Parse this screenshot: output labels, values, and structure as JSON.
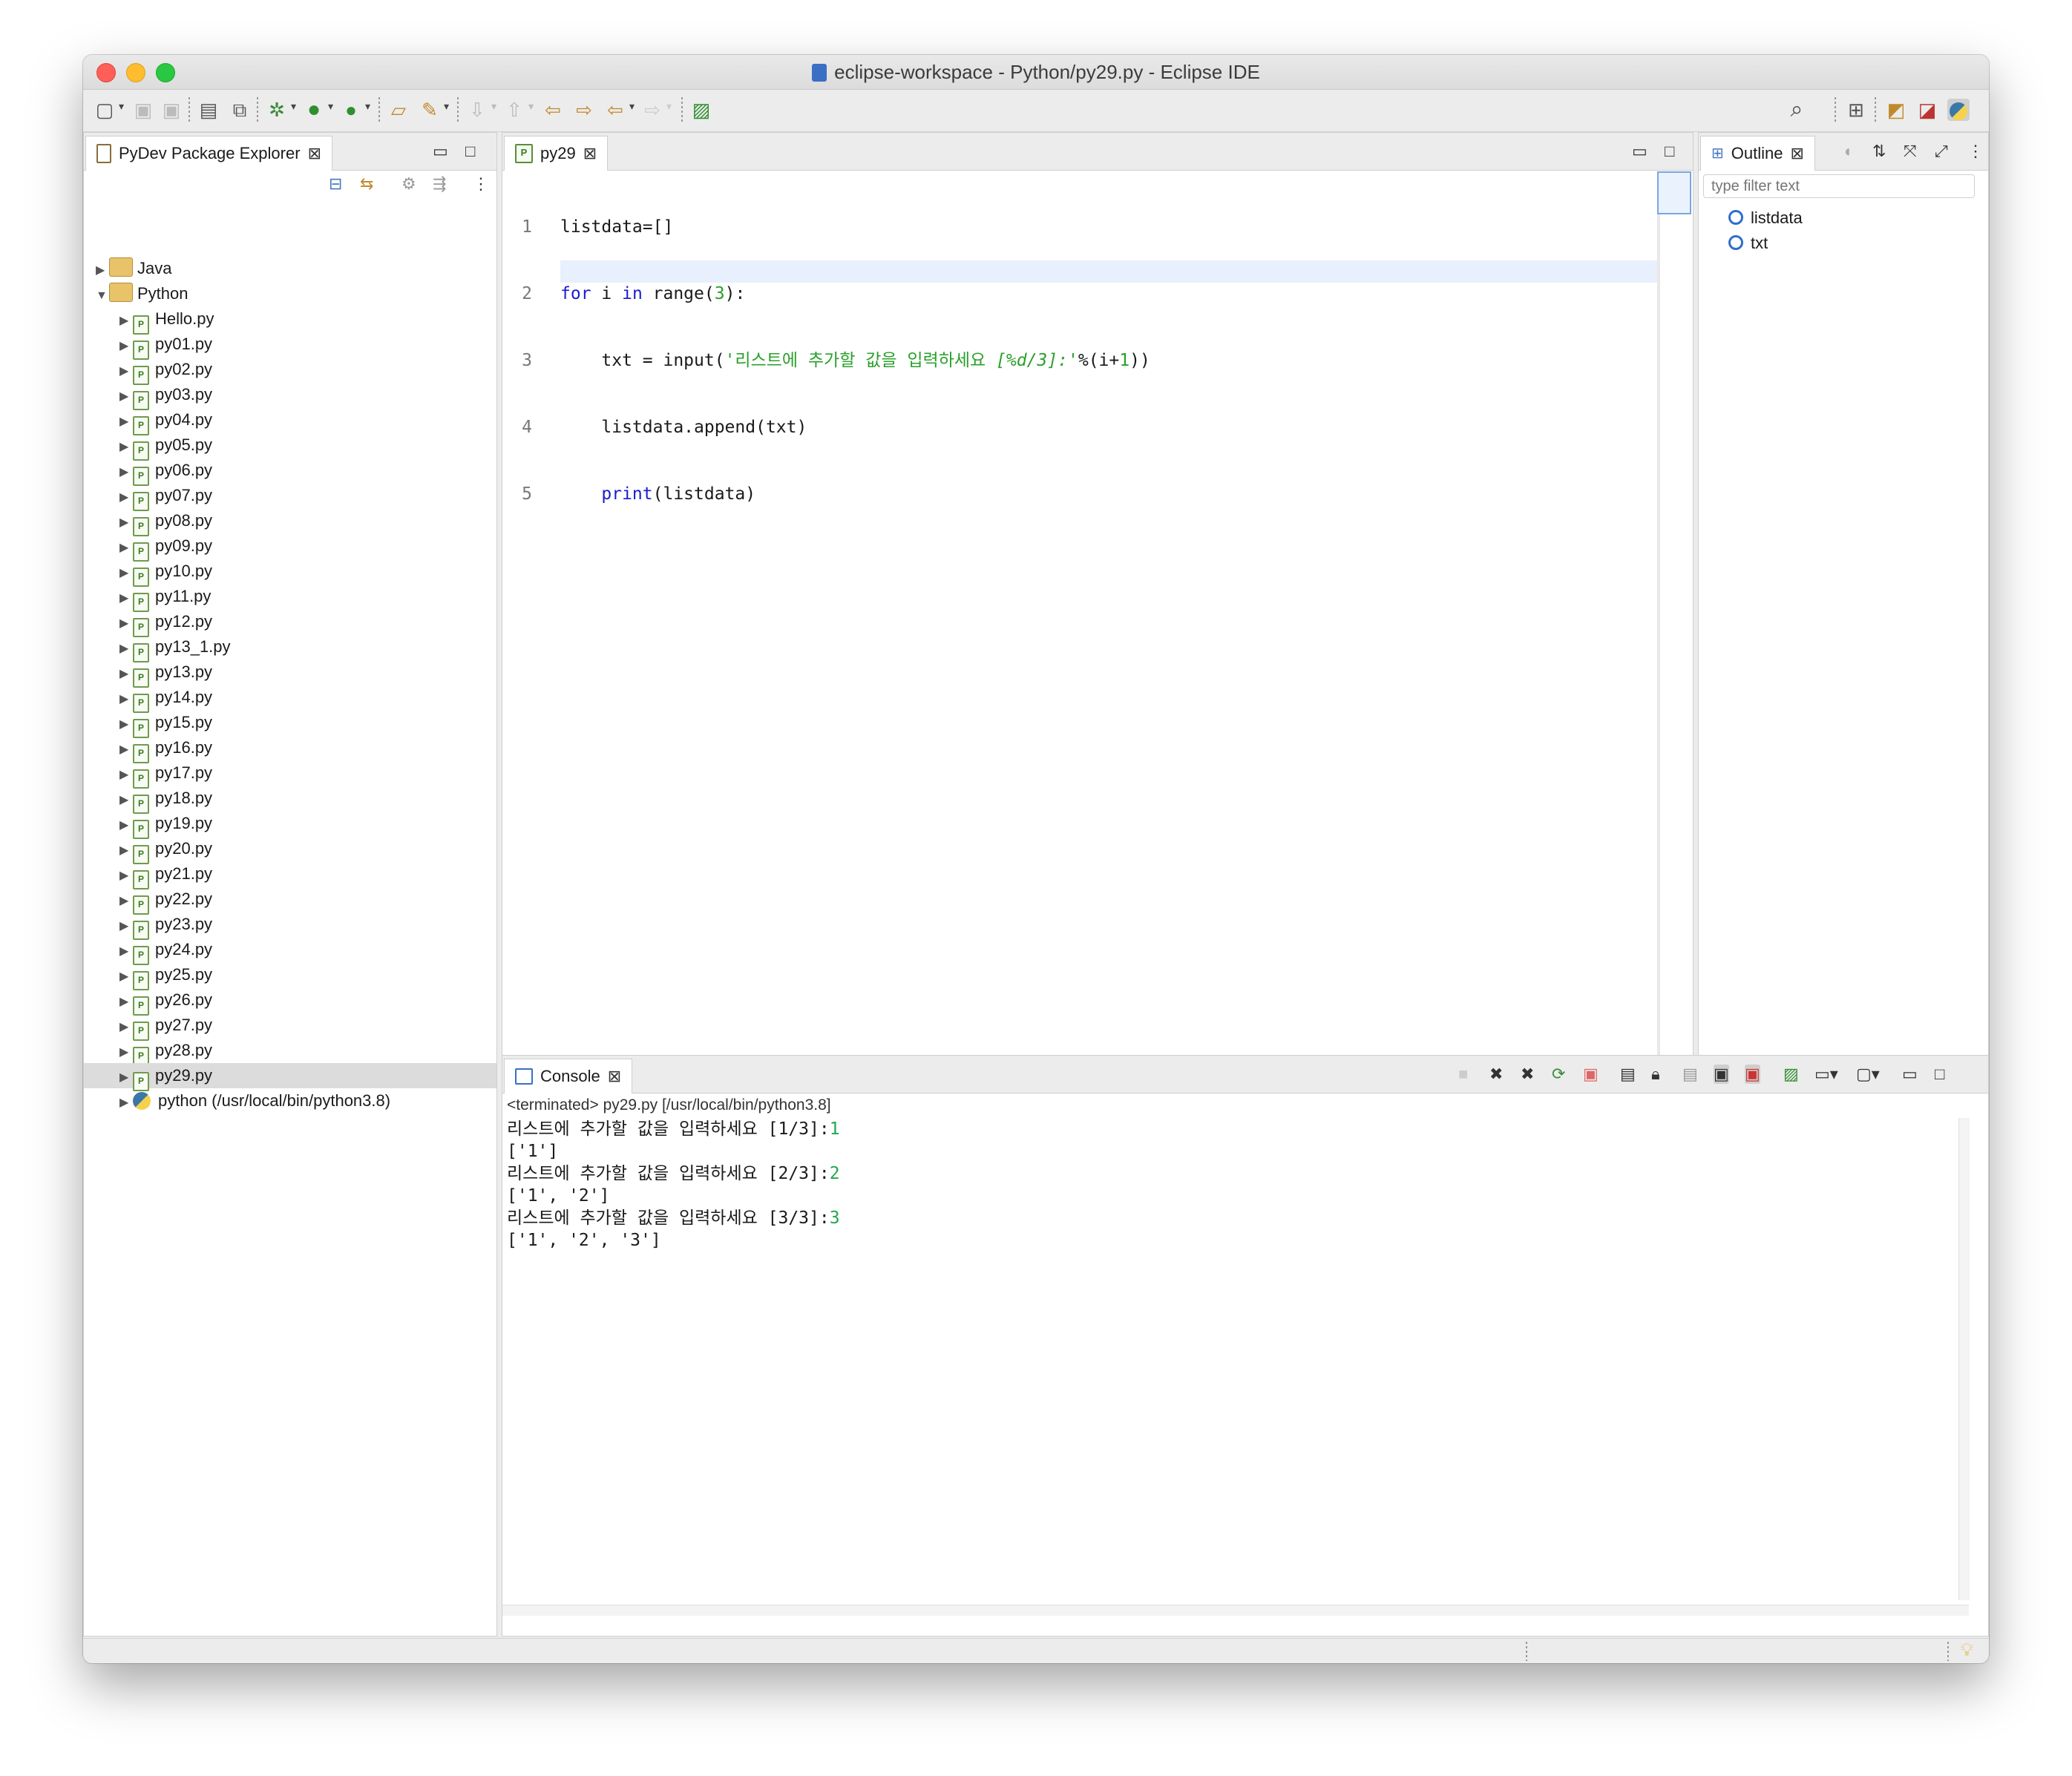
{
  "window": {
    "title": "eclipse-workspace - Python/py29.py - Eclipse IDE"
  },
  "explorer": {
    "tab_label": "PyDev Package Explorer",
    "projects": [
      {
        "name": "Java",
        "expanded": false
      },
      {
        "name": "Python",
        "expanded": true
      }
    ],
    "files": [
      "Hello.py",
      "py01.py",
      "py02.py",
      "py03.py",
      "py04.py",
      "py05.py",
      "py06.py",
      "py07.py",
      "py08.py",
      "py09.py",
      "py10.py",
      "py11.py",
      "py12.py",
      "py13_1.py",
      "py13.py",
      "py14.py",
      "py15.py",
      "py16.py",
      "py17.py",
      "py18.py",
      "py19.py",
      "py20.py",
      "py21.py",
      "py22.py",
      "py23.py",
      "py24.py",
      "py25.py",
      "py26.py",
      "py27.py",
      "py28.py",
      "py29.py"
    ],
    "selected_file": "py29.py",
    "interpreter": "python  (/usr/local/bin/python3.8)"
  },
  "editor": {
    "tab_label": "py29",
    "line_numbers": [
      "1",
      "2",
      "3",
      "4",
      "5"
    ],
    "lines": {
      "l1": "listdata=[]",
      "l2_kw1": "for",
      "l2_mid": " i ",
      "l2_kw2": "in",
      "l2_rest": " range(",
      "l2_num": "3",
      "l2_end": "):",
      "l3_pre": "    txt = input(",
      "l3_str": "'리스트에 추가할 값을 입력하세요 ",
      "l3_fmt": "[%d/3]:",
      "l3_strend": "'",
      "l3_post": "%(i+",
      "l3_num": "1",
      "l3_end": "))",
      "l4": "    listdata.append(txt)",
      "l5_indent": "    ",
      "l5_kw": "print",
      "l5_rest": "(listdata)"
    }
  },
  "outline": {
    "tab_label": "Outline",
    "filter_placeholder": "type filter text",
    "items": [
      "listdata",
      "txt"
    ]
  },
  "console": {
    "tab_label": "Console",
    "header": "<terminated> py29.py [/usr/local/bin/python3.8]",
    "output": [
      {
        "text": "리스트에 추가할 값을 입력하세요 [1/3]:",
        "input": "1"
      },
      {
        "text": "['1']",
        "input": ""
      },
      {
        "text": "리스트에 추가할 값을 입력하세요 [2/3]:",
        "input": "2"
      },
      {
        "text": "['1', '2']",
        "input": ""
      },
      {
        "text": "리스트에 추가할 값을 입력하세요 [3/3]:",
        "input": "3"
      },
      {
        "text": "['1', '2', '3']",
        "input": ""
      }
    ]
  },
  "icons": {
    "toolbar": [
      "new-icon",
      "save-icon",
      "save-all-icon",
      "terminal-icon",
      "build-icon",
      "debug-icon",
      "run-icon",
      "external-tools-icon",
      "open-type-icon",
      "search-icon-tb",
      "next-annotation-icon",
      "prev-annotation-icon",
      "back-icon",
      "forward-icon",
      "pin-editor-icon",
      "search-icon",
      "open-perspective-icon",
      "java-perspective-icon",
      "debug-perspective-icon",
      "python-perspective-icon"
    ]
  }
}
